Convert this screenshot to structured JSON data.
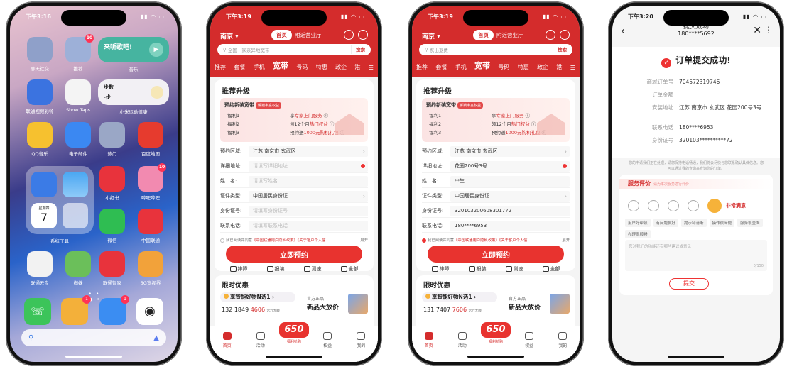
{
  "phone1": {
    "time": "下午3:16",
    "apps": [
      {
        "label": "聊天社交",
        "color": "#8fa0c9"
      },
      {
        "label": "推荐",
        "color": "#9db0d8",
        "badge": "10"
      },
      {
        "label": "联通视频彩铃",
        "color": "#3b73e0"
      },
      {
        "label": "Show Taps",
        "color": "#f4f4f4"
      },
      {
        "label": "QQ音乐",
        "color": "#f6c12f"
      },
      {
        "label": "电子邮件",
        "color": "#3b88f2"
      },
      {
        "label": "热门",
        "color": "#9aa7c6"
      },
      {
        "label": "百度地图",
        "color": "#e63b2e"
      },
      {
        "label": "小红书",
        "color": "#e8333c"
      },
      {
        "label": "哔哩哔哩",
        "color": "#f28ab0",
        "badge": "10"
      },
      {
        "label": "微信",
        "color": "#2fbd52"
      },
      {
        "label": "中国联通",
        "color": "#e8333c"
      },
      {
        "label": "联通云盘",
        "color": "#f2f2f2"
      },
      {
        "label": "蜘蛛",
        "color": "#6bbf5a"
      },
      {
        "label": "联通智家",
        "color": "#e8333c"
      },
      {
        "label": "5G宽视界",
        "color": "#f2a23a"
      }
    ],
    "music_widget": {
      "title": "来听歌吧!",
      "label": "音乐"
    },
    "steps_widget": {
      "title": "步数",
      "value": "-步",
      "label": "小米运动健康"
    },
    "folder_label": "系统工具",
    "calendar": {
      "weekday": "星期四",
      "day": "7"
    }
  },
  "unicom_common": {
    "city": "南京",
    "tab_home": "首页",
    "tab_hall": "附近营业厅",
    "search_button": "搜索",
    "categories": [
      "推荐",
      "套餐",
      "手机",
      "宽带",
      "号码",
      "特惠",
      "政企",
      "港"
    ],
    "section_title": "推荐升级",
    "promo_title": "预约新装宽带",
    "promo_tag": "解锁丰富权益",
    "benefits": [
      {
        "name": "福利1",
        "pre": "享",
        "hl": "专家上门服务"
      },
      {
        "name": "福利2",
        "pre": "领12个月",
        "hl": "热门权益"
      },
      {
        "name": "福利3",
        "pre": "预约送",
        "hl": "1000元购机礼包"
      }
    ],
    "labels": {
      "region": "预约区域:",
      "address": "详细地址:",
      "name": "姓　名:",
      "idtype": "证件类型:",
      "idno": "身份证号:",
      "phone": "联系电话:"
    },
    "agree_pre": "我已阅读并同意",
    "agree_link": "《中国联通用户隐私政策》《关于客户个人信…",
    "agree_more": "展开",
    "submit": "立即预约",
    "quick": [
      "排障",
      "报装",
      "测速",
      "全部"
    ],
    "limited_title": "限时优惠",
    "pill": "享智能好物N选1",
    "official": "官方正品",
    "new_product": "新品大放价",
    "tabs": [
      "首页",
      "活动",
      "",
      "权益",
      "我的"
    ],
    "promo_badge": "650",
    "promo_badge_sub": "福利抢购"
  },
  "phone2": {
    "time": "下午3:19",
    "search_placeholder": "全国一家亲异地宽带",
    "region": "江苏 南京市 玄武区",
    "address": "请填写详细地址",
    "name": "请填写姓名",
    "idtype": "中国居民身份证",
    "idno": "请填写身份证号",
    "phone": "请填写联系电话",
    "number_pre": "132 1849 ",
    "number_hl": "4606",
    "number_note": "六六大顺"
  },
  "phone3": {
    "time": "下午3:19",
    "search_placeholder": "携出退费",
    "region": "江苏 南京市 玄武区",
    "address": "花园200号3号",
    "name": "**生",
    "idtype": "中国居民身份证",
    "idno": "320103200608301772",
    "phone": "180****6953",
    "number_pre": "131 7407 ",
    "number_hl": "7606",
    "number_note": "六六大顺"
  },
  "phone4": {
    "time": "下午3:20",
    "nav_title": "提交成功",
    "nav_sub": "180****5692",
    "success_title": "订单提交成功!",
    "rows": [
      {
        "k": "商城订单号",
        "v": "704572319746"
      },
      {
        "k": "订单金额",
        "v": ""
      },
      {
        "k": "安装地址",
        "v": "江苏 南京市 玄武区 花园200号3号"
      },
      {
        "k": "联系电话",
        "v": "180****6953"
      },
      {
        "k": "身份证号",
        "v": "320103**********72"
      }
    ],
    "note": "您的申请我们正在处理，请您保持电话畅通，我们将会尽快与您联系确认具体信息。您可以通过我的查询来查询您的订单。",
    "eval_title": "服务评价",
    "eval_hint": "请为本次服务进行评价",
    "eval_selected": "非常满意",
    "chips": [
      "用户好帮顿",
      "有问题友好",
      "提示特清晰",
      "操作很简便",
      "服务很全面",
      "办理很顺畅"
    ],
    "textarea_placeholder": "您对我们的功能还有哪些建议或意见",
    "counter": "0/150",
    "submit": "提交"
  }
}
